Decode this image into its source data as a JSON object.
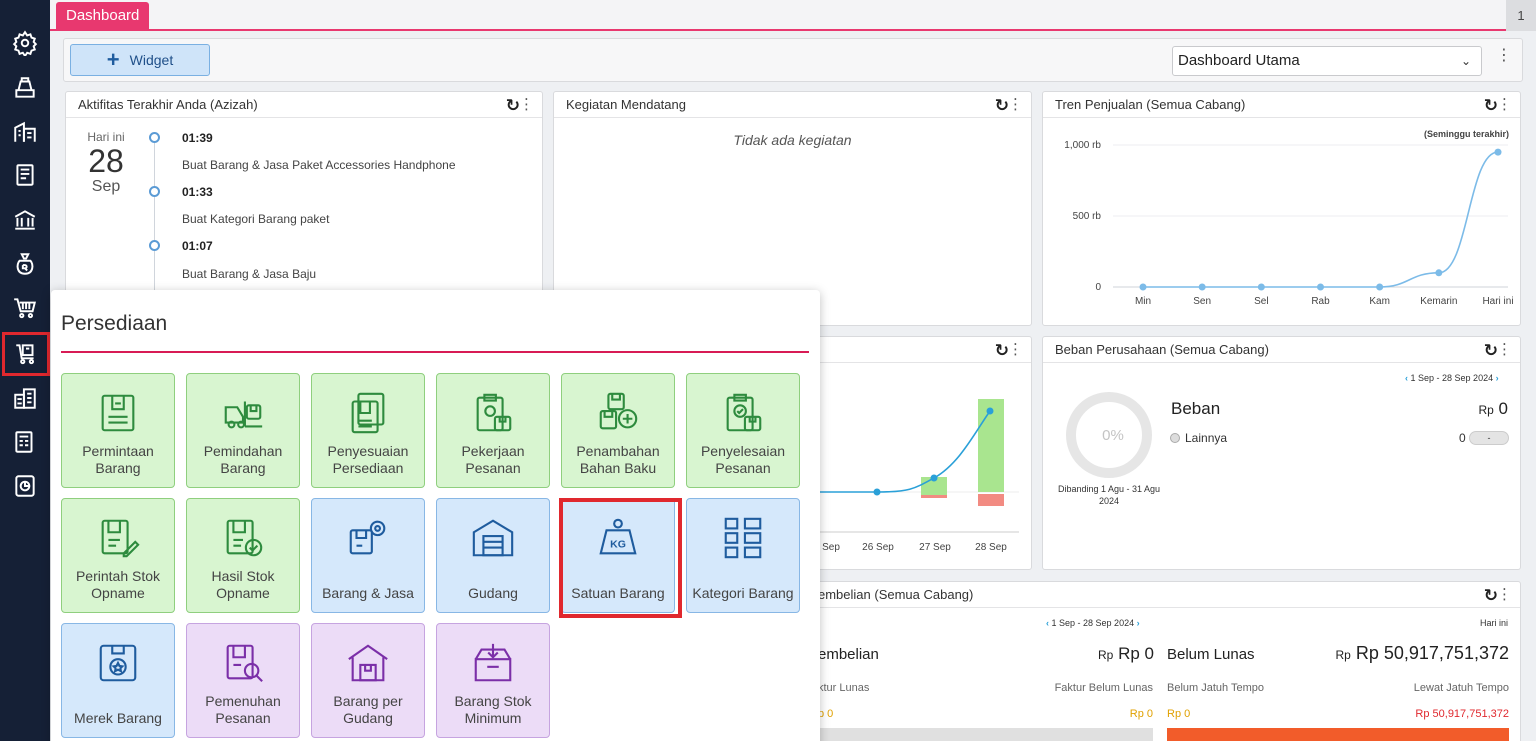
{
  "topbar": {
    "tab_label": "Dashboard",
    "tab_count": "1"
  },
  "toolbar": {
    "widget_label": "Widget",
    "dashboard_select": "Dashboard Utama"
  },
  "activity": {
    "title": "Aktifitas Terakhir Anda (Azizah)",
    "day_label": "Hari ini",
    "day_number": "28",
    "month": "Sep",
    "items": [
      {
        "time": "01:39",
        "desc": "Buat Barang & Jasa Paket Accessories Handphone"
      },
      {
        "time": "01:33",
        "desc": "Buat Kategori Barang paket"
      },
      {
        "time": "01:07",
        "desc": "Buat Barang & Jasa Baju"
      }
    ]
  },
  "upcoming": {
    "title": "Kegiatan Mendatang",
    "empty_text": "Tidak ada kegiatan"
  },
  "sales_trend": {
    "title": "Tren Penjualan (Semua Cabang)",
    "subtitle": "(Seminggu terakhir)",
    "y_ticks": [
      "1,000 rb",
      "500 rb",
      "0"
    ]
  },
  "chart_data": {
    "type": "line",
    "title": "Tren Penjualan (Semua Cabang)",
    "subtitle": "(Seminggu terakhir)",
    "categories": [
      "Min",
      "Sen",
      "Sel",
      "Rab",
      "Kam",
      "Kemarin",
      "Hari ini"
    ],
    "values": [
      0,
      0,
      0,
      0,
      0,
      100,
      950
    ],
    "ylim": [
      0,
      1000
    ],
    "y_unit": "rb",
    "grid": true
  },
  "mid_chart": {
    "x_labels": [
      "Sep",
      "26 Sep",
      "27 Sep",
      "28 Sep"
    ]
  },
  "beban": {
    "title": "Beban Perusahaan (Semua Cabang)",
    "range": "1 Sep - 28 Sep 2024",
    "donut_pct": "0%",
    "compare_text": "Dibanding 1 Agu - 31 Agu 2024",
    "label": "Beban",
    "currency": "Rp",
    "amount": "0",
    "other_label": "Lainnya",
    "other_value": "0",
    "other_badge": "-"
  },
  "purchase": {
    "title": "embelian (Semua Cabang)",
    "range": "1 Sep - 28 Sep 2024",
    "today": "Hari ini",
    "left_label": "embelian",
    "left_currency": "Rp",
    "left_amount": "Rp 0",
    "left_sub1": "ktur Lunas",
    "left_sub2": "Faktur Belum Lunas",
    "left_val1": "p 0",
    "left_val2": "Rp 0",
    "right_label": "Belum Lunas",
    "right_currency": "Rp",
    "right_amount": "Rp 50,917,751,372",
    "right_sub1": "Belum Jatuh Tempo",
    "right_sub2": "Lewat Jatuh Tempo",
    "right_val1": "Rp 0",
    "right_val2": "Rp 50,917,751,372"
  },
  "popup": {
    "title": "Persediaan",
    "tiles": [
      {
        "label": "Permintaan Barang",
        "icon": "request-doc-icon",
        "color": "green"
      },
      {
        "label": "Pemindahan Barang",
        "icon": "forklift-icon",
        "color": "green"
      },
      {
        "label": "Penyesuaian Persediaan",
        "icon": "adjust-doc-icon",
        "color": "green"
      },
      {
        "label": "Pekerjaan Pesanan",
        "icon": "clipboard-gear-icon",
        "color": "green"
      },
      {
        "label": "Penambahan Bahan Baku",
        "icon": "box-plus-icon",
        "color": "green"
      },
      {
        "label": "Penyelesaian Pesanan",
        "icon": "clipboard-check-icon",
        "color": "green"
      },
      {
        "label": "Perintah Stok Opname",
        "icon": "doc-pencil-icon",
        "color": "green"
      },
      {
        "label": "Hasil Stok Opname",
        "icon": "doc-check-icon",
        "color": "green"
      },
      {
        "label": "Barang & Jasa",
        "icon": "box-gear-icon",
        "color": "blue"
      },
      {
        "label": "Gudang",
        "icon": "warehouse-icon",
        "color": "blue"
      },
      {
        "label": "Satuan Barang",
        "icon": "kg-weight-icon",
        "color": "blue",
        "weight_text": "KG"
      },
      {
        "label": "Kategori Barang",
        "icon": "grid-category-icon",
        "color": "blue"
      },
      {
        "label": "Merek Barang",
        "icon": "brand-box-icon",
        "color": "blue"
      },
      {
        "label": "Pemenuhan Pesanan",
        "icon": "doc-search-icon",
        "color": "purple"
      },
      {
        "label": "Barang per Gudang",
        "icon": "house-box-icon",
        "color": "purple"
      },
      {
        "label": "Barang Stok Minimum",
        "icon": "box-down-icon",
        "color": "purple"
      }
    ]
  },
  "colors": {
    "accent": "#e8386f",
    "sidebar": "#152036",
    "highlight": "#e0282e"
  }
}
